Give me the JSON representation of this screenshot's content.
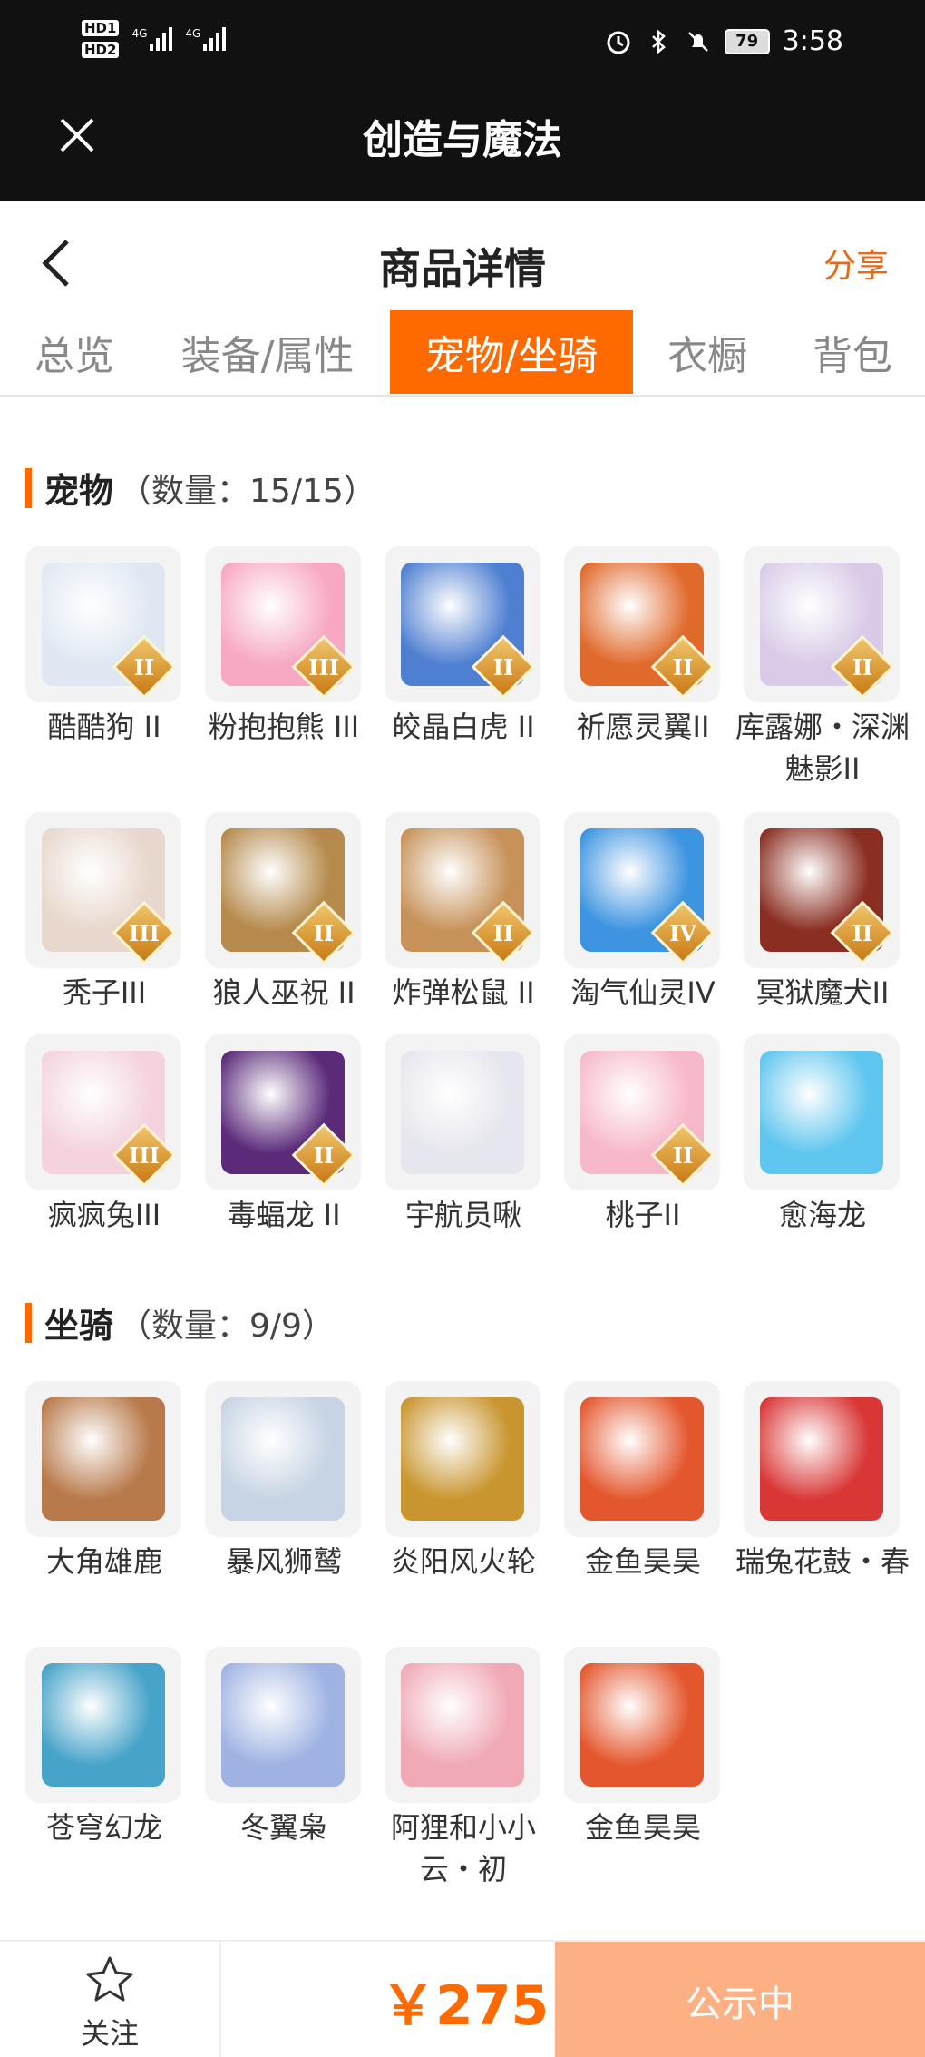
{
  "status_bar": {
    "hd1": "HD1",
    "hd2": "HD2",
    "net1": "4G",
    "net2": "4G",
    "battery": "79",
    "time": "3:58"
  },
  "app": {
    "title": "创造与魔法"
  },
  "header": {
    "title": "商品详情",
    "share": "分享"
  },
  "tabs": [
    {
      "label": "总览",
      "active": false
    },
    {
      "label": "装备/属性",
      "active": false
    },
    {
      "label": "宠物/坐骑",
      "active": true
    },
    {
      "label": "衣橱",
      "active": false
    },
    {
      "label": "背包",
      "active": false
    }
  ],
  "pets": {
    "title": "宠物",
    "count": "（数量：15/15）",
    "items": [
      {
        "name": "酷酷狗 II",
        "badge": "II",
        "color": "#dfe8f2"
      },
      {
        "name": "粉抱抱熊 III",
        "badge": "III",
        "color": "#f7a9c3"
      },
      {
        "name": "皎晶白虎 II",
        "badge": "II",
        "color": "#4f7fd1"
      },
      {
        "name": "祈愿灵翼II",
        "badge": "II",
        "color": "#e06a2c"
      },
      {
        "name": "库露娜・深渊魅影II",
        "badge": "II",
        "color": "#d9cbe8"
      },
      {
        "name": "秃子III",
        "badge": "III",
        "color": "#e8d7cc"
      },
      {
        "name": "狼人巫祝 II",
        "badge": "II",
        "color": "#b58a4c"
      },
      {
        "name": "炸弹松鼠 II",
        "badge": "II",
        "color": "#c7925a"
      },
      {
        "name": "淘气仙灵IV",
        "badge": "IV",
        "color": "#3d94e0"
      },
      {
        "name": "冥狱魔犬II",
        "badge": "II",
        "color": "#8a2e22"
      },
      {
        "name": "疯疯兔III",
        "badge": "III",
        "color": "#f4d3df"
      },
      {
        "name": "毒蝠龙 II",
        "badge": "II",
        "color": "#5b2b7a"
      },
      {
        "name": "宇航员啾",
        "badge": "",
        "color": "#e6e6ee"
      },
      {
        "name": "桃子II",
        "badge": "II",
        "color": "#f7b9c9"
      },
      {
        "name": "愈海龙",
        "badge": "",
        "color": "#5fc6ef"
      }
    ]
  },
  "mounts": {
    "title": "坐骑",
    "count": "（数量：9/9）",
    "items": [
      {
        "name": "大角雄鹿",
        "color": "#b87a4b"
      },
      {
        "name": "暴风狮鹫",
        "color": "#c7d4e4"
      },
      {
        "name": "炎阳风火轮",
        "color": "#c9952e"
      },
      {
        "name": "金鱼昊昊",
        "color": "#e4572e"
      },
      {
        "name": "瑞兔花鼓・春",
        "color": "#d93636"
      },
      {
        "name": "苍穹幻龙",
        "color": "#46a3c9"
      },
      {
        "name": "冬翼枭",
        "color": "#9fb3e3"
      },
      {
        "name": "阿狸和小小云・初",
        "color": "#f0a9b5"
      },
      {
        "name": "金鱼昊昊",
        "color": "#e4572e"
      }
    ]
  },
  "bottom": {
    "follow": "关注",
    "price": "￥275",
    "status": "公示中"
  }
}
